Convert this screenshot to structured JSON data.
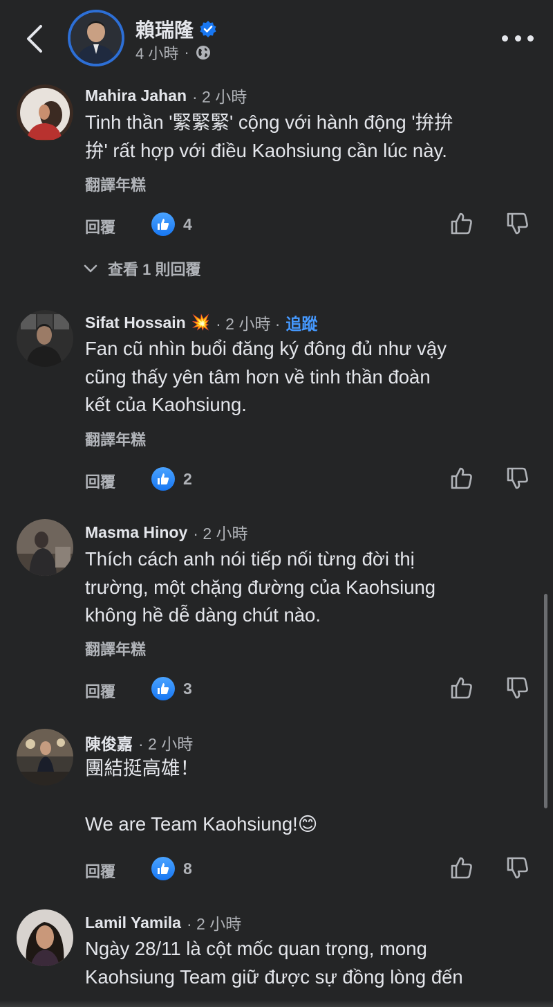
{
  "header": {
    "name": "賴瑞隆",
    "time": "4 小時"
  },
  "comments": [
    {
      "name": "Mahira Jahan",
      "time": "· 2 小時",
      "text": "Tinh thần '緊緊緊' cộng với hành động '拚拚\n拚' rất hợp với điều Kaohsiung cần lúc này.",
      "translate": "翻譯年糕",
      "reply": "回覆",
      "likes": "4",
      "view_replies": "查看 1 則回覆"
    },
    {
      "name": "Sifat Hossain",
      "badge": "💥",
      "time": "· 2 小時 ·",
      "follow": "追蹤",
      "text": "Fan cũ nhìn buổi đăng ký đông đủ như vậy\ncũng thấy yên tâm hơn về tinh thần đoàn\nkết của Kaohsiung.",
      "translate": "翻譯年糕",
      "reply": "回覆",
      "likes": "2"
    },
    {
      "name": "Masma Hinoy",
      "time": "· 2 小時",
      "text": "Thích cách anh nói tiếp nối từng đời thị\ntrường, một chặng đường của Kaohsiung\nkhông hề dễ dàng chút nào.",
      "translate": "翻譯年糕",
      "reply": "回覆",
      "likes": "3"
    },
    {
      "name": "陳俊嘉",
      "time": "· 2 小時",
      "text": "團結挺高雄！\n\nWe are Team Kaohsiung!😊",
      "reply": "回覆",
      "likes": "8"
    },
    {
      "name": "Lamil Yamila",
      "time": "· 2 小時",
      "text": "Ngày 28/11 là cột mốc quan trọng, mong\nKaohsiung Team giữ được sự đồng lòng đến"
    }
  ],
  "colors": {
    "background": "#242526",
    "text": "#e4e6eb",
    "muted": "#b0b3b8",
    "link": "#4599ff",
    "like": "#1877f2"
  }
}
